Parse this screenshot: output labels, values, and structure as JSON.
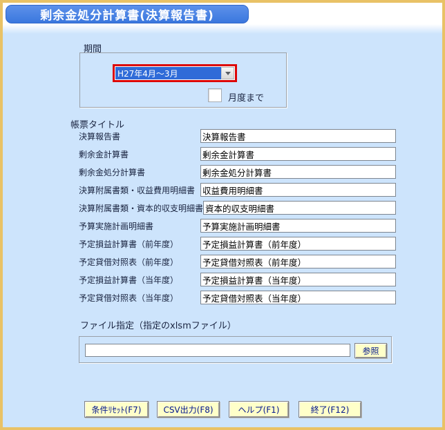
{
  "window": {
    "title": "剰余金処分計算書(決算報告書)"
  },
  "period": {
    "section_label": "期間",
    "dropdown": {
      "selected_value": "H27年4月～3月",
      "highlighted": true
    },
    "checkbox": {
      "label": "月度まで",
      "checked": false
    }
  },
  "report_titles": {
    "section_label": "帳票タイトル",
    "rows": [
      {
        "label": "決算報告書",
        "value": "決算報告書"
      },
      {
        "label": "剰余金計算書",
        "value": "剰余金計算書"
      },
      {
        "label": "剰余金処分計算書",
        "value": "剰余金処分計算書"
      },
      {
        "label": "決算附属書類・収益費用明細書",
        "value": "収益費用明細書"
      },
      {
        "label": "決算附属書類・資本的収支明細書",
        "value": "資本的収支明細書"
      },
      {
        "label": "予算実施計画明細書",
        "value": "予算実施計画明細書"
      },
      {
        "label": "予定損益計算書（前年度）",
        "value": "予定損益計算書（前年度）"
      },
      {
        "label": "予定貸借対照表（前年度）",
        "value": "予定貸借対照表（前年度）"
      },
      {
        "label": "予定損益計算書（当年度）",
        "value": "予定損益計算書（当年度）"
      },
      {
        "label": "予定貸借対照表（当年度）",
        "value": "予定貸借対照表（当年度）"
      }
    ]
  },
  "file_spec": {
    "section_label": "ファイル指定（指定のxlsmファイル）",
    "input_value": "",
    "browse_button_label": "参照"
  },
  "footer_buttons": [
    {
      "label": "条件ﾘｾｯﾄ(F7)"
    },
    {
      "label": "CSV出力(F8)"
    },
    {
      "label": "ヘルプ(F1)"
    },
    {
      "label": "終了(F12)"
    }
  ],
  "colors": {
    "window_border_gold": "#e9c266",
    "background_blue": "#cde4fc",
    "title_bar_blue": "#3a77de",
    "selection_blue": "#2f6bd8",
    "highlight_red": "#dd0505",
    "button_yellow": "#ffffc9",
    "button_text_navy": "#00148c",
    "label_text": "#1a2440"
  }
}
